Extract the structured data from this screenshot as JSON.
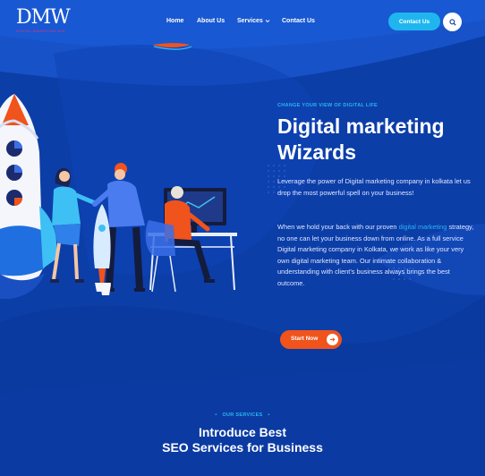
{
  "brand": {
    "logo_text": "DMW",
    "logo_subtitle": "DIGITAL MARKETING WIZ"
  },
  "nav": {
    "items": [
      {
        "label": "Home"
      },
      {
        "label": "About Us"
      },
      {
        "label": "Services"
      },
      {
        "label": "Contact Us"
      }
    ],
    "contact_button": "Contact Us"
  },
  "hero": {
    "eyebrow": "CHANGE YOUR VIEW OF DIGITAL LIFE",
    "title_line1": "Digital marketing",
    "title_line2": "Wizards",
    "para1": "Leverage the power of Digital marketing company in kolkata let us drop the most powerful spell on your business!",
    "para2_before": "When we hold your back with our proven ",
    "para2_link": "digital marketing",
    "para2_after": " strategy, no one can let your business down from online. As a full service Digital marketing company in Kolkata, we work as like your very own digital marketing team. Our intimate collaboration & understanding with client's business always brings the best outcome.",
    "cta": "Start Now"
  },
  "services": {
    "eyebrow": "OUR SERVICES",
    "title_line1": "Introduce Best",
    "title_line2": "SEO Services for Business"
  },
  "colors": {
    "background": "#0c3ea8",
    "accent_blue": "#1fb6f0",
    "accent_orange": "#f0531c"
  },
  "icons": {
    "search": "search-icon",
    "dropdown": "chevron-down-icon",
    "cta_arrow": "arrow-right-icon"
  }
}
